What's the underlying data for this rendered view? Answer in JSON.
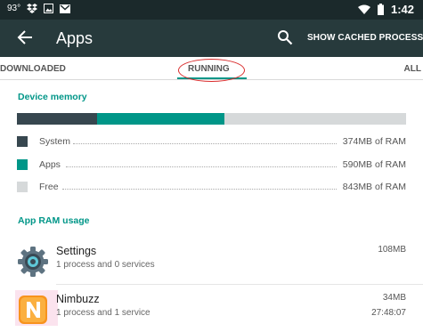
{
  "status_bar": {
    "temperature": "93°",
    "time": "1:42"
  },
  "app_bar": {
    "title": "Apps",
    "cached_button_label": "SHOW CACHED PROCESSES"
  },
  "tabs": [
    {
      "label": "DOWNLOADED"
    },
    {
      "label": "RUNNING",
      "selected": true
    },
    {
      "label": "ALL"
    }
  ],
  "device_memory": {
    "title": "Device memory",
    "items": [
      {
        "label": "System",
        "value": "374MB of RAM",
        "color": "#37474f",
        "mb": 374
      },
      {
        "label": "Apps",
        "value": "590MB of RAM",
        "color": "#009688",
        "mb": 590
      },
      {
        "label": "Free",
        "value": "843MB of RAM",
        "color": "#d6d9da",
        "mb": 843
      }
    ]
  },
  "app_ram": {
    "title": "App RAM usage",
    "apps": [
      {
        "name": "Settings",
        "subtitle": "1 process and 0 services",
        "size": "108MB",
        "time": "",
        "icon": "settings-gear-icon"
      },
      {
        "name": "Nimbuzz",
        "subtitle": "1 process and 1 service",
        "size": "34MB",
        "time": "27:48:07",
        "icon": "nimbuzz-icon"
      }
    ]
  },
  "colors": {
    "accent": "#009688",
    "toolbar": "#273a3c",
    "status_bar": "#1b292b",
    "annotation": "#d92b2b"
  }
}
